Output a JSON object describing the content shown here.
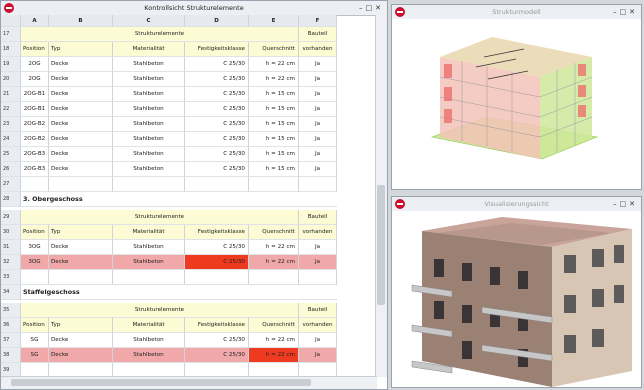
{
  "sheet_window": {
    "title": "Kontrollsicht Strukturelemente"
  },
  "model_window": {
    "title": "Strukturmodell"
  },
  "render_window": {
    "title": "Visualisierungssicht"
  },
  "columns": [
    "A",
    "B",
    "C",
    "D",
    "E",
    "F"
  ],
  "rows": [
    {
      "n": "17",
      "type": "group",
      "group": "Strukturelemente",
      "bauteil": "Bauteil"
    },
    {
      "n": "18",
      "type": "header",
      "cells": [
        "Position",
        "Typ",
        "Materialität",
        "Festigkeitsklasse",
        "Querschnitt",
        "vorhanden"
      ]
    },
    {
      "n": "19",
      "type": "data",
      "cells": [
        "2OG",
        "Decke",
        "Stahlbeton",
        "C 25/30",
        "h = 22 cm",
        "Ja"
      ]
    },
    {
      "n": "20",
      "type": "data",
      "cells": [
        "2OG",
        "Decke",
        "Stahlbeton",
        "C 25/30",
        "h = 22 cm",
        "Ja"
      ]
    },
    {
      "n": "21",
      "type": "data",
      "cells": [
        "2OG-B1",
        "Decke",
        "Stahlbeton",
        "C 25/30",
        "h = 15 cm",
        "Ja"
      ]
    },
    {
      "n": "22",
      "type": "data",
      "cells": [
        "2OG-B1",
        "Decke",
        "Stahlbeton",
        "C 25/30",
        "h = 15 cm",
        "Ja"
      ]
    },
    {
      "n": "23",
      "type": "data",
      "cells": [
        "2OG-B2",
        "Decke",
        "Stahlbeton",
        "C 25/30",
        "h = 15 cm",
        "Ja"
      ]
    },
    {
      "n": "24",
      "type": "data",
      "cells": [
        "2OG-B2",
        "Decke",
        "Stahlbeton",
        "C 25/30",
        "h = 15 cm",
        "Ja"
      ]
    },
    {
      "n": "25",
      "type": "data",
      "cells": [
        "2OG-B3",
        "Decke",
        "Stahlbeton",
        "C 25/30",
        "h = 15 cm",
        "Ja"
      ]
    },
    {
      "n": "26",
      "type": "data",
      "cells": [
        "2OG-B3",
        "Decke",
        "Stahlbeton",
        "C 25/30",
        "h = 15 cm",
        "Ja"
      ]
    },
    {
      "n": "27",
      "type": "empty"
    },
    {
      "n": "28",
      "type": "section",
      "label": "3. Obergeschoss"
    },
    {
      "n": "29",
      "type": "group",
      "group": "Strukturelemente",
      "bauteil": "Bauteil"
    },
    {
      "n": "30",
      "type": "header",
      "cells": [
        "Position",
        "Typ",
        "Materialität",
        "Festigkeitsklasse",
        "Querschnitt",
        "vorhanden"
      ]
    },
    {
      "n": "31",
      "type": "data",
      "cells": [
        "3OG",
        "Decke",
        "Stahlbeton",
        "C 25/30",
        "h = 22 cm",
        "Ja"
      ]
    },
    {
      "n": "32",
      "type": "data",
      "hl": true,
      "red": 3,
      "cells": [
        "3OG",
        "Decke",
        "Stahlbeton",
        "C 25/30",
        "h = 22 cm",
        "Ja"
      ]
    },
    {
      "n": "33",
      "type": "empty"
    },
    {
      "n": "34",
      "type": "section",
      "label": "Staffelgeschoss"
    },
    {
      "n": "35",
      "type": "group",
      "group": "Strukturelemente",
      "bauteil": "Bauteil"
    },
    {
      "n": "36",
      "type": "header",
      "cells": [
        "Position",
        "Typ",
        "Materialität",
        "Festigkeitsklasse",
        "Querschnitt",
        "vorhanden"
      ]
    },
    {
      "n": "37",
      "type": "data",
      "cells": [
        "SG",
        "Decke",
        "Stahlbeton",
        "C 25/30",
        "h = 22 cm",
        "Ja"
      ]
    },
    {
      "n": "38",
      "type": "data",
      "hl": true,
      "red": 4,
      "cells": [
        "SG",
        "Decke",
        "Stahlbeton",
        "C 25/30",
        "h = 22 cm",
        "Ja"
      ]
    },
    {
      "n": "39",
      "type": "empty"
    }
  ],
  "colors": {
    "highlight_row": "#f0a8a8",
    "error_cell": "#ee3a1f",
    "header_fill": "#fdfbd3",
    "accent": "#c8102e"
  },
  "icons": {
    "app": "app-logo-icon",
    "minimize": "minimize-icon",
    "maximize": "maximize-icon",
    "close": "close-icon"
  }
}
